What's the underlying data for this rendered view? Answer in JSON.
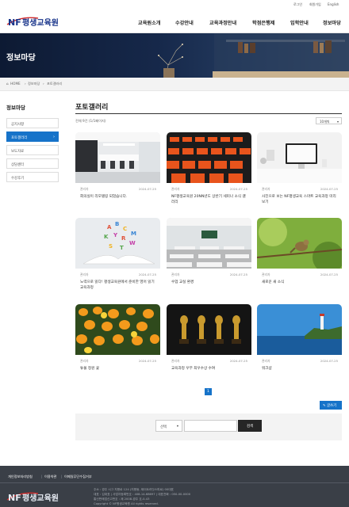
{
  "util_links": [
    "로그인",
    "회원가입",
    "English"
  ],
  "logo_text": "NF 평생교육원",
  "nav": [
    "교육원소개",
    "수강안내",
    "교육과정안내",
    "학점은행제",
    "입학안내",
    "정보마당"
  ],
  "hero_title": "정보마당",
  "breadcrumb": [
    "HOME",
    "정보마당",
    "포토갤러리"
  ],
  "side": {
    "title": "정보마당",
    "items": [
      "공지사항",
      "포토갤러리",
      "보도자료",
      "상담센터",
      "수강후기"
    ],
    "active_index": 1
  },
  "main": {
    "title": "포토갤러리",
    "count": "전체 9건 (1/1페이지)",
    "per_page": "10개씩"
  },
  "cards": [
    {
      "author": "관리자",
      "date": "2024-07-25",
      "title": "회의실이 리모델링 되었습니다."
    },
    {
      "author": "관리자",
      "date": "2024-07-25",
      "title": "NF평생교육원 20NN년도 상반기 세미나 소식 갤러리"
    },
    {
      "author": "관리자",
      "date": "2024-07-25",
      "title": "사진으로 보는 NF평생교육 스마트 교육과정 미리보기"
    },
    {
      "author": "관리자",
      "date": "2024-07-25",
      "title": "노력으로 읽다! 평생교육원에서 준비한 영어 읽기 교육과정"
    },
    {
      "author": "관리자",
      "date": "2024-07-25",
      "title": "수업 교실 환경"
    },
    {
      "author": "관리자",
      "date": "2024-07-25",
      "title": "새로운 새 소식"
    },
    {
      "author": "관리자",
      "date": "2024-07-25",
      "title": "튜울 정원 꽃"
    },
    {
      "author": "관리자",
      "date": "2024-07-25",
      "title": "교육과정 우부 최우수상 수여"
    },
    {
      "author": "관리자",
      "date": "2024-07-25",
      "title": "워크샵"
    }
  ],
  "pagination": {
    "current": "1"
  },
  "write_label": "글쓰기",
  "search": {
    "select": "선택",
    "button": "검색"
  },
  "footer": {
    "links": [
      "개인정보처리방침",
      "이용약관",
      "이메일무단수집거부"
    ],
    "logo_text": "NF 평생교육원",
    "info": [
      "주소 : 경주 시그 지평로 124 (지평동, 제이트리닷스피로) 00대표",
      "대표 : 김대표 | 사업자등록번호 : 408-14-68697 | 대표전화 : 050-00-0000",
      "통신판매업신고번호 : 제 2008-경주 호-0-43",
      "Copyright © NF평생교육원 All rights reserved."
    ]
  },
  "colors": {
    "accent": "#1673c9",
    "footer_bg": "#3a3f47",
    "logo_blue": "#17338a",
    "logo_red": "#d52b2b"
  }
}
